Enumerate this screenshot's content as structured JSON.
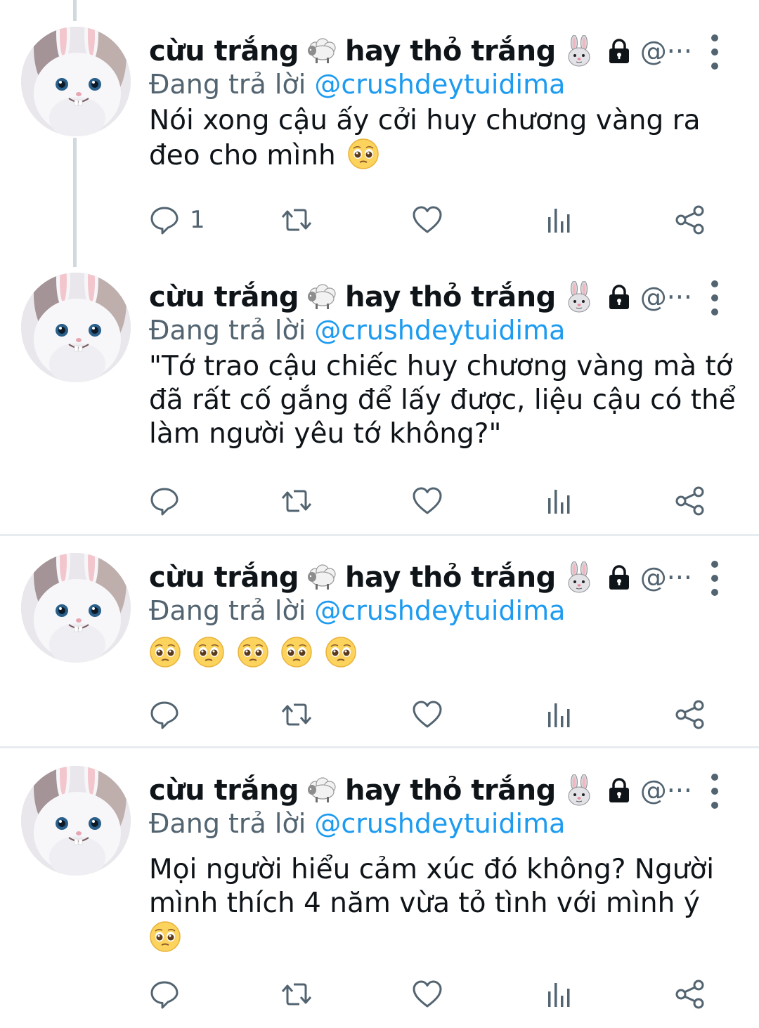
{
  "author": {
    "display_name_1": "cừu trắng",
    "display_name_2": "hay thỏ trắng",
    "handle": "@···"
  },
  "icons": {
    "sheep": "sheep-emoji",
    "rabbit": "rabbit-face-emoji",
    "lock": "lock-icon",
    "more": "more-vertical-icon",
    "reply": "reply-icon",
    "retweet": "retweet-icon",
    "like": "heart-icon",
    "views": "analytics-icon",
    "share": "share-icon",
    "pleading": "pleading-face-emoji"
  },
  "colors": {
    "mention": "#1d9bf0",
    "secondary_text": "#536471",
    "primary_text": "#0f1419"
  },
  "tweets": [
    {
      "replying_label": "Đang trả lời",
      "replying_to": "@crushdeytuidima",
      "text": "Nói xong cậu ấy cởi huy chương vàng ra đeo cho mình",
      "reply_count": "1"
    },
    {
      "replying_label": "Đang trả lời",
      "replying_to": "@crushdeytuidima",
      "text": "\"Tớ trao cậu chiếc huy chương vàng mà tớ đã rất cố gắng để lấy được, liệu cậu có thể làm người yêu tớ không?\"",
      "reply_count": ""
    },
    {
      "replying_label": "Đang trả lời",
      "replying_to": "@crushdeytuidima",
      "text": "",
      "reply_count": ""
    },
    {
      "replying_label": "Đang trả lời",
      "replying_to": "@crushdeytuidima",
      "text": "Mọi người hiểu cảm xúc đó không? Người mình thích 4 năm vừa tỏ tình với mình ý",
      "reply_count": ""
    }
  ]
}
